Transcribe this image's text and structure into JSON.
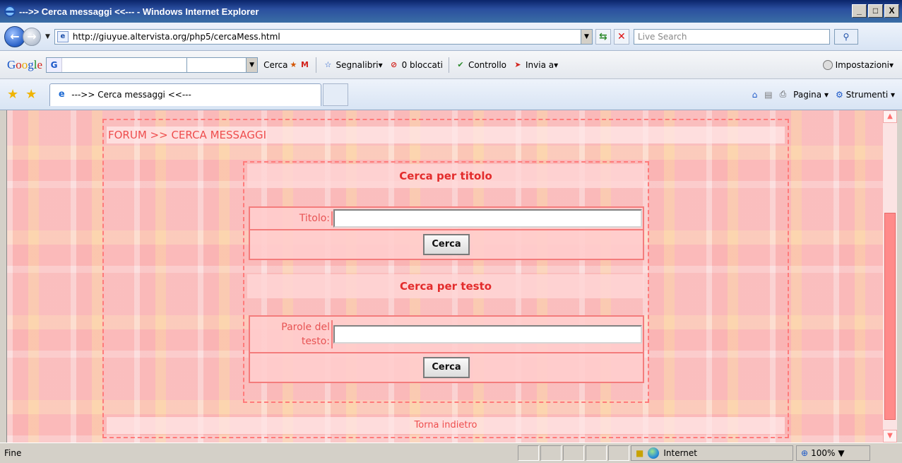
{
  "window": {
    "title": "--->> Cerca messaggi <<--- - Windows Internet Explorer",
    "controls": [
      "_",
      "□",
      "X"
    ]
  },
  "address": {
    "url": "http://giuyue.altervista.org/php5/cercaMess.html",
    "search_placeholder": "Live Search"
  },
  "google_toolbar": {
    "cerca_label": "Cerca",
    "segnalibri_label": "Segnalibri▾",
    "bloccati_label": "0 bloccati",
    "controllo_label": "Controllo",
    "invia_label": "Invia a▾",
    "impostazioni_label": "Impostazioni▾"
  },
  "tabs": {
    "active_label": "--->> Cerca messaggi <<---"
  },
  "command_bar": {
    "pagina_label": "Pagina",
    "strumenti_label": "Strumenti"
  },
  "page": {
    "breadcrumb": "FORUM >> CERCA MESSAGGI",
    "title_section": {
      "heading": "Cerca per titolo",
      "label": "Titolo:",
      "input_value": "",
      "button": "Cerca"
    },
    "text_section": {
      "heading": "Cerca per testo",
      "label": "Parole del testo:",
      "input_value": "",
      "button": "Cerca"
    },
    "back_link": "Torna indietro"
  },
  "status": {
    "text": "Fine",
    "zone": "Internet",
    "zoom": "100%"
  },
  "icons": {
    "ie_logo": "ie-logo-icon",
    "back": "back-arrow-icon",
    "forward": "forward-arrow-icon",
    "refresh": "refresh-icon",
    "stop": "stop-icon",
    "search": "search-icon",
    "favorites": "favorites-star-icon",
    "add_favorites": "add-favorites-icon",
    "home": "home-icon",
    "feeds": "feeds-icon",
    "print": "print-icon",
    "tools": "gear-icon",
    "globe": "globe-icon"
  },
  "colors": {
    "accent": "#ee4d4d",
    "heading": "#e32c2c",
    "border": "#f47c7c",
    "scroll_thumb": "#ff8a8a"
  }
}
